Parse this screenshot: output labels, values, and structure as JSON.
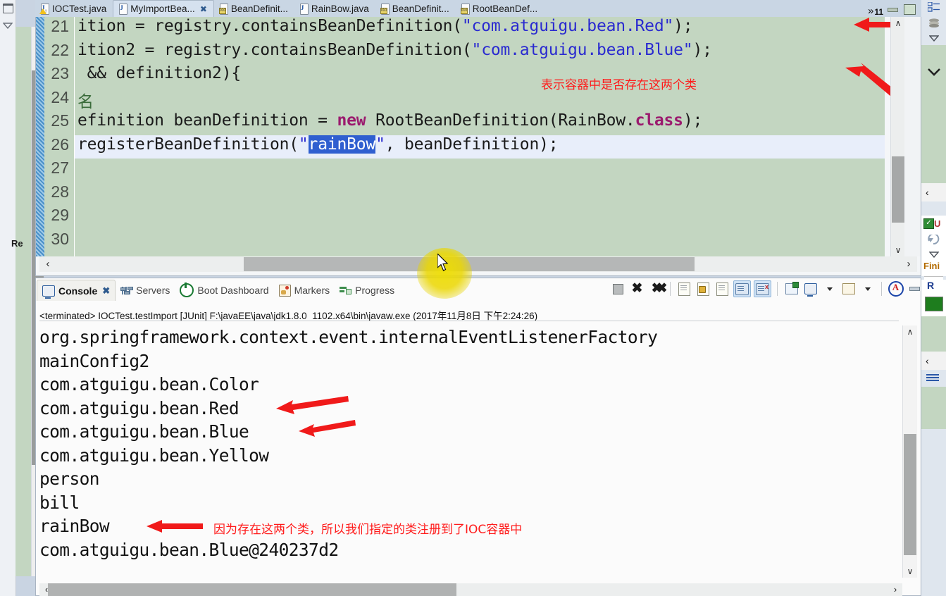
{
  "editor": {
    "tabs": [
      {
        "label": "IOCTest.java",
        "icon": "java-file-warning-icon",
        "active": false,
        "closable": false
      },
      {
        "label": "MyImportBea...",
        "icon": "java-file-icon",
        "active": true,
        "closable": true
      },
      {
        "label": "BeanDefinit...",
        "icon": "class-file-icon",
        "active": false,
        "closable": false
      },
      {
        "label": "RainBow.java",
        "icon": "java-file-icon",
        "active": false,
        "closable": false
      },
      {
        "label": "BeanDefinit...",
        "icon": "class-file-icon",
        "active": false,
        "closable": false
      },
      {
        "label": "RootBeanDef...",
        "icon": "class-file-icon",
        "active": false,
        "closable": false
      }
    ],
    "overflow": {
      "chevrons": "»",
      "count": "11"
    },
    "window_buttons": {
      "minimize": "minimize-icon",
      "maximize": "maximize-icon"
    },
    "lines": [
      {
        "num": "21",
        "segments": [
          {
            "t": "ition = registry.containsBeanDefinition(",
            "c": "plain"
          },
          {
            "t": "\"com.atguigu.bean.Red\"",
            "c": "str"
          },
          {
            "t": ");",
            "c": "plain"
          }
        ]
      },
      {
        "num": "22",
        "segments": [
          {
            "t": "ition2 = registry.containsBeanDefinition(",
            "c": "plain"
          },
          {
            "t": "\"com.atguigu.bean.Blue\"",
            "c": "str"
          },
          {
            "t": ");",
            "c": "plain"
          }
        ]
      },
      {
        "num": "23",
        "segments": [
          {
            "t": " && definition2){",
            "c": "plain"
          }
        ]
      },
      {
        "num": "24",
        "segments": [
          {
            "t": "名",
            "c": "cn"
          }
        ]
      },
      {
        "num": "25",
        "segments": [
          {
            "t": "efinition beanDefinition = ",
            "c": "plain"
          },
          {
            "t": "new",
            "c": "kw"
          },
          {
            "t": " RootBeanDefinition(RainBow.",
            "c": "plain"
          },
          {
            "t": "class",
            "c": "kw"
          },
          {
            "t": ");",
            "c": "plain"
          }
        ]
      },
      {
        "num": "26",
        "highlight": true,
        "segments": [
          {
            "t": "registerBeanDefinition(",
            "c": "plain"
          },
          {
            "t": "\"",
            "c": "str"
          },
          {
            "t": "rainBow",
            "c": "sel"
          },
          {
            "t": "\"",
            "c": "str"
          },
          {
            "t": ", beanDefinition);",
            "c": "plain"
          }
        ]
      },
      {
        "num": "27",
        "segments": []
      },
      {
        "num": "28",
        "segments": []
      },
      {
        "num": "29",
        "segments": []
      },
      {
        "num": "30",
        "segments": []
      }
    ],
    "annotation": "表示容器中是否存在这两个类",
    "scroll_up": "∧",
    "scroll_down": "∨",
    "scroll_left": "‹",
    "scroll_right": "›"
  },
  "console": {
    "tabs": [
      {
        "label": "Console",
        "icon": "console-icon",
        "active": true,
        "closable": true
      },
      {
        "label": "Servers",
        "icon": "servers-icon",
        "active": false,
        "closable": false
      },
      {
        "label": "Boot Dashboard",
        "icon": "boot-dashboard-icon",
        "active": false,
        "closable": false
      },
      {
        "label": "Markers",
        "icon": "markers-icon",
        "active": false,
        "closable": false
      },
      {
        "label": "Progress",
        "icon": "progress-icon",
        "active": false,
        "closable": false
      }
    ],
    "toolbar": [
      {
        "name": "terminate-button",
        "icon": "stop-square-icon"
      },
      {
        "name": "remove-launch-button",
        "icon": "x-icon"
      },
      {
        "name": "remove-all-terminated-button",
        "icon": "xx-icon"
      },
      {
        "name": "clear-console-button",
        "icon": "clear-doc-icon"
      },
      {
        "name": "lock-scroll-button",
        "icon": "lock-doc-icon"
      },
      {
        "name": "word-wrap-button",
        "icon": "wrap-doc-icon"
      },
      {
        "name": "scroll-lock-button",
        "icon": "scroll-lock-icon",
        "active": true
      },
      {
        "name": "show-console-on-error-button",
        "icon": "console-error-icon",
        "active": true
      },
      {
        "name": "pin-console-button",
        "icon": "pin-icon"
      },
      {
        "name": "display-selected-console-button",
        "icon": "monitor-icon"
      },
      {
        "name": "display-selected-console-dropdown",
        "icon": "chevron-down-icon"
      },
      {
        "name": "open-console-button",
        "icon": "new-console-icon"
      },
      {
        "name": "open-console-dropdown",
        "icon": "chevron-down-icon"
      },
      {
        "name": "ansi-console-button",
        "icon": "at-circle-icon"
      },
      {
        "name": "minimize-view-button",
        "icon": "minimize-icon"
      },
      {
        "name": "maximize-view-button",
        "icon": "maximize-icon"
      }
    ],
    "terminated_line": "<terminated> IOCTest.testImport [JUnit] F:\\javaEE\\java\\jdk1.8.0_1102.x64\\bin\\javaw.exe (2017年11月8日 下午2:24:26)",
    "output": [
      "org.springframework.context.event.internalEventListenerFactory",
      "mainConfig2",
      "com.atguigu.bean.Color",
      "com.atguigu.bean.Red",
      "com.atguigu.bean.Blue",
      "com.atguigu.bean.Yellow",
      "person",
      "bill",
      "rainBow",
      "com.atguigu.bean.Blue@240237d2"
    ],
    "annotation": "因为存在这两个类，所以我们指定的类注册到了IOC容器中"
  },
  "left_rail": {
    "restore_icon": "restore-view-icon",
    "collapse_icon": "chevron-down-icon",
    "vertical_label": "Re",
    "scroll_up": "∧",
    "scroll_down": "∨"
  },
  "right_rail": {
    "outline_icon": "outline-view-icon",
    "stack_icon": "stack-icon",
    "chevron_icon": "chevron-down-icon",
    "check_icon": "checked-box-icon",
    "u_label": "U",
    "finish_label": "Fini",
    "r_label": "R",
    "collapse_left": "‹",
    "menu_icon": "hamburger-icon"
  },
  "colors": {
    "editor_bg": "#c3d6c1",
    "annotation_red": "#ff1a1a",
    "string_blue": "#2a2ad0",
    "keyword_magenta": "#9b1a6e",
    "selection_blue": "#2f5fd0",
    "tab_active": "#d5e1ef"
  }
}
